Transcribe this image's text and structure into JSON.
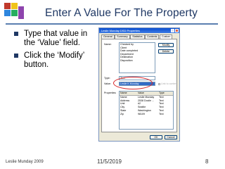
{
  "slide": {
    "title": "Enter A Value For The Property",
    "bullets": [
      "Type that value in the ‘Value’ field.",
      "Click the ‘Modify’ button."
    ],
    "logo_icon": "presenter-logo-icon",
    "colors": {
      "title": "#1f3864",
      "rule": "#5b7fb0",
      "highlight_ring": "#d9262a"
    }
  },
  "dialog": {
    "title": "Leslie Munday DSD Properties",
    "tabs": [
      "General",
      "Summary",
      "Statistics",
      "Contents",
      "Custom"
    ],
    "active_tab": "Custom",
    "name_label": "Name:",
    "name_list": [
      "Checked by",
      "Client",
      "Date completed",
      "Department",
      "Destination",
      "Disposition"
    ],
    "modify_button": "Modify",
    "delete_button": "Delete",
    "type_label": "Type:",
    "type_value": "Text",
    "value_label": "Value:",
    "value_value": "Leslie K Munday",
    "link_label": "Link to content",
    "properties_label": "Properties:",
    "properties_columns": [
      "Name",
      "Value",
      "Type"
    ],
    "properties_rows": [
      [
        "Name",
        "Leslie Munday",
        "Text"
      ],
      [
        "Address",
        "2538 Docile ...",
        "Text"
      ],
      [
        "Unit",
        "#2",
        "Text"
      ],
      [
        "City",
        "Seattle",
        "Text"
      ],
      [
        "State",
        "Washington",
        "Text"
      ],
      [
        "Zip",
        "98109",
        "Text"
      ]
    ],
    "ok_button": "OK",
    "cancel_button": "Cancel"
  },
  "footer": {
    "author": "Leslie Munday 2009",
    "date": "11/5/2019",
    "page": "8"
  }
}
